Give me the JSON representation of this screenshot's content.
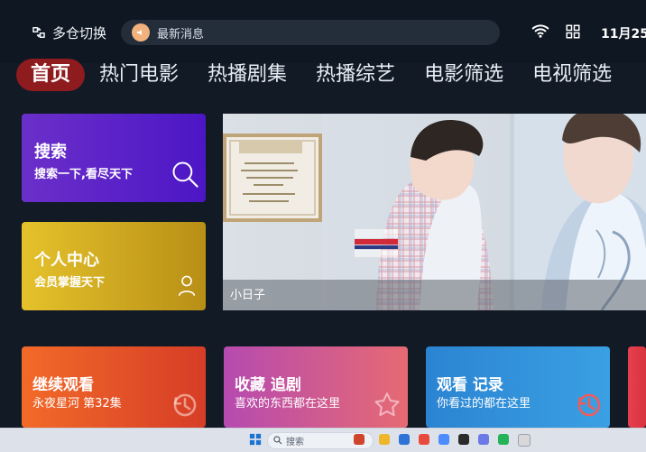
{
  "top_bar": {
    "switch_label": "多仓切换",
    "notice_label": "最新消息",
    "date_text": "11月25"
  },
  "nav": {
    "items": [
      "首页",
      "热门电影",
      "热播剧集",
      "热播综艺",
      "电影筛选",
      "电视筛选"
    ]
  },
  "cards": {
    "search": {
      "title": "搜索",
      "subtitle": "搜索一下,看尽天下"
    },
    "profile": {
      "title": "个人中心",
      "subtitle": "会员掌握天下"
    }
  },
  "banner": {
    "title": "小日子"
  },
  "bottom_cards": [
    {
      "title": "继续观看",
      "subtitle": "永夜星河 第32集"
    },
    {
      "title": "收藏 追剧",
      "subtitle": "喜欢的东西都在这里"
    },
    {
      "title": "观看 记录",
      "subtitle": "你看过的都在这里"
    },
    {
      "title": "",
      "subtitle": ""
    }
  ],
  "taskbar": {
    "search_placeholder": "搜索"
  },
  "colors": {
    "background": "#121a26",
    "topbar": "#0f1722",
    "nav_active": "#8e1b1e",
    "search_card": "#5a21c9",
    "profile_card": "#d2ac22",
    "continue_card": "#e95628",
    "favorite_card": "#cf5e92",
    "history_card": "#3591da",
    "taskbar": "#dde1ea"
  },
  "icons": {
    "switch": "switch-icon",
    "notice": "megaphone-icon",
    "wifi": "wifi-icon",
    "grid": "grid-icon",
    "search": "search-icon",
    "user": "user-icon",
    "history": "history-icon",
    "star": "star-icon",
    "windows": "windows-icon"
  }
}
